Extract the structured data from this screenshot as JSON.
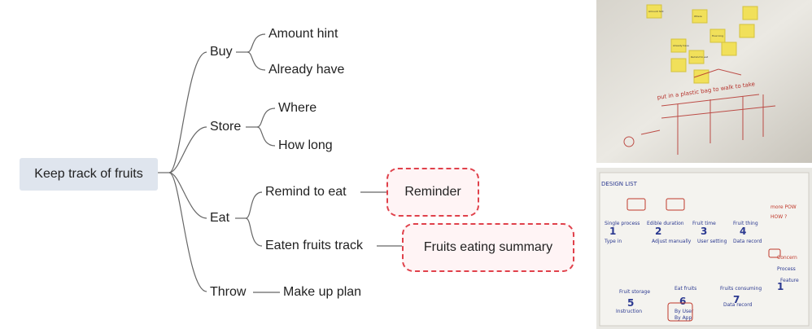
{
  "mindmap": {
    "root": "Keep track of fruits",
    "branches": [
      {
        "label": "Buy",
        "children": [
          {
            "label": "Amount hint"
          },
          {
            "label": "Already have"
          }
        ]
      },
      {
        "label": "Store",
        "children": [
          {
            "label": "Where"
          },
          {
            "label": "How long"
          }
        ]
      },
      {
        "label": "Eat",
        "children": [
          {
            "label": "Remind to eat",
            "leaf": "Reminder"
          },
          {
            "label": "Eaten fruits track",
            "leaf": "Fruits eating summary"
          }
        ]
      },
      {
        "label": "Throw",
        "children": [
          {
            "label": "Make up plan"
          }
        ]
      }
    ]
  },
  "colors": {
    "root_fill": "#dfe5ee",
    "highlight": "#e0414b",
    "line": "#666666"
  },
  "photos": {
    "top": {
      "sticky_notes": [
        "Amount hint",
        "Where",
        "Already have",
        "How long",
        "Remind to eat"
      ],
      "caption": "put in a plastic bag to walk to take"
    },
    "bottom": {
      "title": "DESIGN LIST",
      "notes": [
        "Single process",
        "Edible duration",
        "Fruit time",
        "Fruit thing",
        "Type in",
        "Adjust manually",
        "User setting",
        "Data record",
        "Fruit storage",
        "Eat fruits",
        "Fruits consuming",
        "Instruction",
        "Data record",
        "Concern",
        "Process",
        "Feature",
        "more POW",
        "HOW ?",
        "By User",
        "By App"
      ],
      "numbers": [
        "1",
        "2",
        "3",
        "4",
        "5",
        "6",
        "7",
        "1"
      ]
    }
  }
}
